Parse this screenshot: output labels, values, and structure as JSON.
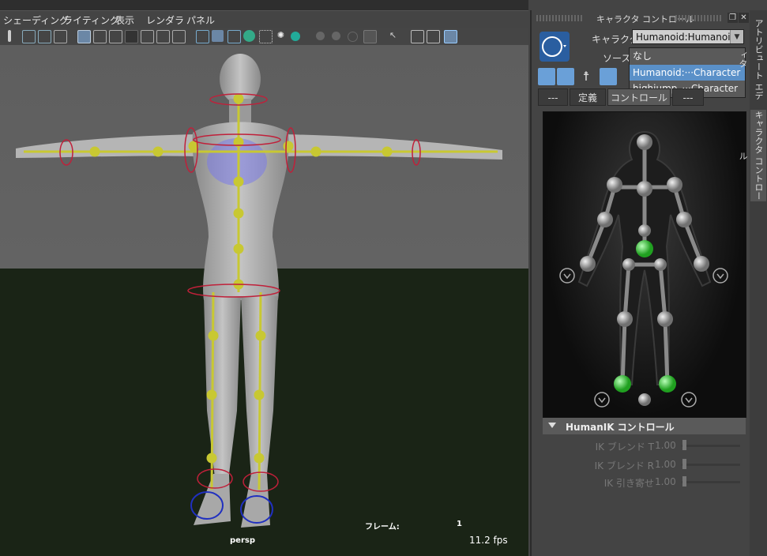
{
  "menu": [
    "シェーディング",
    "ライティング",
    "表示",
    "レンダラ",
    "パネル"
  ],
  "viewport": {
    "camera": "persp",
    "frame_label": "フレーム:",
    "frame_value": "1",
    "fps": "11.2 fps"
  },
  "panel": {
    "title": "キャラクタ コントロール",
    "character_label": "キャラクタ:",
    "character_value": "Humanoid:Humanoid",
    "source_label": "ソース:",
    "source_options": [
      {
        "label": "なし",
        "selected": false
      },
      {
        "label": "Humanoid:···Character",
        "selected": true
      },
      {
        "label": "highjump_···Character",
        "selected": false
      }
    ],
    "tabs": [
      {
        "label": "---",
        "selected": false
      },
      {
        "label": "定義",
        "selected": false
      },
      {
        "label": "コントロール",
        "selected": true
      },
      {
        "label": "---",
        "selected": false
      }
    ],
    "humanik_header": "HumanIK コントロール",
    "sliders": [
      {
        "label": "IK ブレンド T",
        "value": "1.00"
      },
      {
        "label": "IK ブレンド R",
        "value": "1.00"
      },
      {
        "label": "IK 引き寄せ",
        "value": "1.00"
      }
    ]
  },
  "side_tabs": [
    "アトリビュート エディタ",
    "キャラクタ コントロール"
  ],
  "colors": {
    "accent": "#5a90c8",
    "effector_green": "#2ecc2e",
    "skeleton_yellow": "#c8c832"
  }
}
